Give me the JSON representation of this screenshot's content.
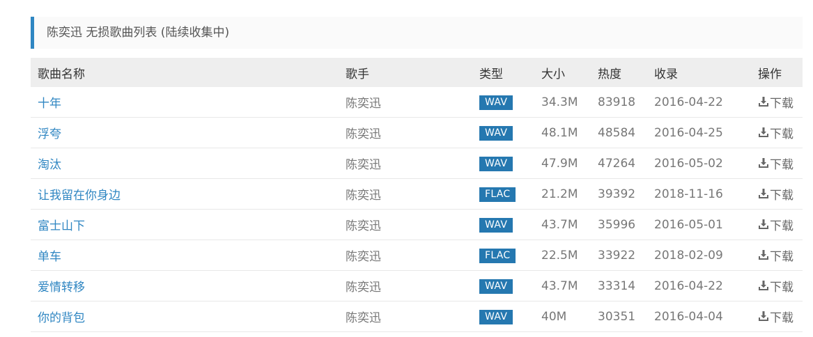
{
  "panel": {
    "title": "陈奕迅 无损歌曲列表 (陆续收集中)"
  },
  "table": {
    "headers": {
      "name": "歌曲名称",
      "artist": "歌手",
      "type": "类型",
      "size": "大小",
      "heat": "热度",
      "added": "收录",
      "action": "操作"
    },
    "download_label": "下载",
    "rows": [
      {
        "name": "十年",
        "artist": "陈奕迅",
        "type": "WAV",
        "size": "34.3M",
        "heat": "83918",
        "added": "2016-04-22"
      },
      {
        "name": "浮夸",
        "artist": "陈奕迅",
        "type": "WAV",
        "size": "48.1M",
        "heat": "48584",
        "added": "2016-04-25"
      },
      {
        "name": "淘汰",
        "artist": "陈奕迅",
        "type": "WAV",
        "size": "47.9M",
        "heat": "47264",
        "added": "2016-05-02"
      },
      {
        "name": "让我留在你身边",
        "artist": "陈奕迅",
        "type": "FLAC",
        "size": "21.2M",
        "heat": "39392",
        "added": "2018-11-16"
      },
      {
        "name": "富士山下",
        "artist": "陈奕迅",
        "type": "WAV",
        "size": "43.7M",
        "heat": "35996",
        "added": "2016-05-01"
      },
      {
        "name": "单车",
        "artist": "陈奕迅",
        "type": "FLAC",
        "size": "22.5M",
        "heat": "33922",
        "added": "2018-02-09"
      },
      {
        "name": "爱情转移",
        "artist": "陈奕迅",
        "type": "WAV",
        "size": "43.7M",
        "heat": "33314",
        "added": "2016-04-22"
      },
      {
        "name": "你的背包",
        "artist": "陈奕迅",
        "type": "WAV",
        "size": "40M",
        "heat": "30351",
        "added": "2016-04-04"
      }
    ]
  },
  "icons": {
    "download": "download-icon"
  },
  "colors": {
    "accent": "#2f86c2",
    "badge": "#2578b0"
  }
}
